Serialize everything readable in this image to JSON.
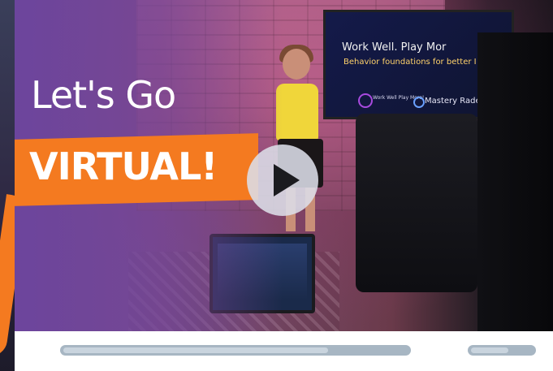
{
  "video": {
    "title_line1": "Let's Go",
    "title_line2": "VIRTUAL!",
    "screen_title": "Work Well. Play Mor",
    "screen_subtitle": "Behavior foundations for better I",
    "screen_logo1_text": "Work Well Play More!",
    "screen_logo2_text": "Mastery Rade"
  },
  "controls": {
    "play_icon": "play-icon",
    "progress": 0.77,
    "volume": 0.6
  },
  "colors": {
    "accent_orange": "#f47a20",
    "purple_overlay": "#6e46a0",
    "track": "#a7b6c3",
    "fill": "#c9d4de"
  }
}
